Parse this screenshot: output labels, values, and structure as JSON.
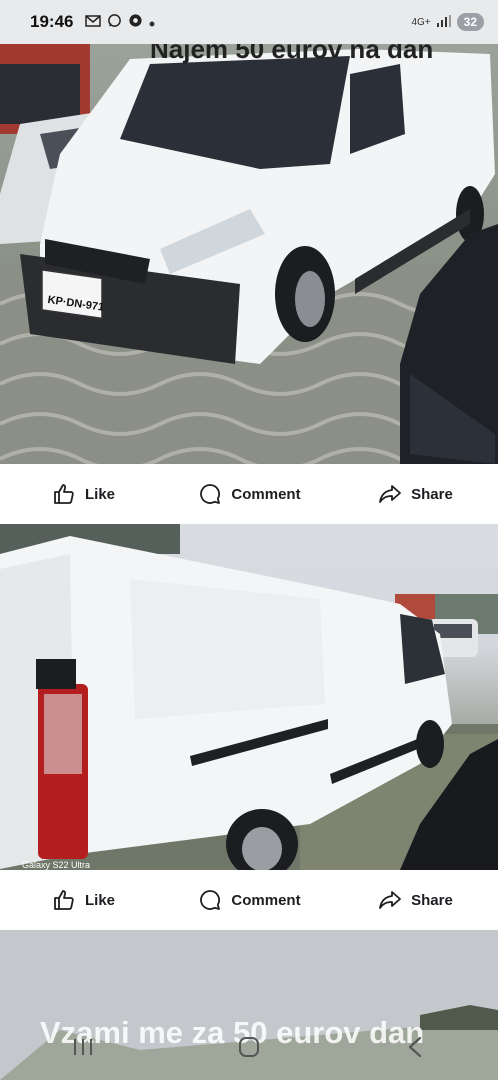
{
  "statusbar": {
    "time": "19:46",
    "notification_icons": [
      "gmail-icon",
      "whatsapp-icon",
      "messenger-icon",
      "dot-icon"
    ],
    "network": "4G+",
    "battery": "32"
  },
  "posts": [
    {
      "image_caption": "Najem 50 eurov na dan",
      "actions": {
        "like": "Like",
        "comment": "Comment",
        "share": "Share"
      }
    },
    {
      "watermark": "Galaxy S22 Ultra",
      "actions": {
        "like": "Like",
        "comment": "Comment",
        "share": "Share"
      }
    },
    {
      "image_caption": "Vzami me za 50 eurov dan"
    }
  ],
  "navbar": {
    "buttons": [
      "recent-apps",
      "home",
      "back"
    ]
  },
  "colors": {
    "action_text": "#1c1e21",
    "card_bg": "#ffffff",
    "page_bg": "#c9ccd1"
  }
}
